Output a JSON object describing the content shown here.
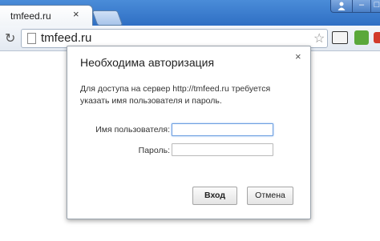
{
  "browser": {
    "tab": {
      "title": "tmfeed.ru",
      "close_glyph": "×"
    },
    "window_controls": {
      "user_icon": "user-icon",
      "minimize": "–",
      "maximize": "□"
    },
    "toolbar": {
      "reload_glyph": "↻",
      "url": "tmfeed.ru",
      "star_glyph": "☆"
    }
  },
  "dialog": {
    "title": "Необходима авторизация",
    "close_glyph": "×",
    "message": "Для доступа на сервер http://tmfeed.ru требуется указать имя пользователя и пароль.",
    "username_label": "Имя пользователя:",
    "username_value": "",
    "password_label": "Пароль:",
    "password_value": "",
    "login_button": "Вход",
    "cancel_button": "Отмена"
  },
  "colors": {
    "titlebar": "#2f6fc4",
    "focus_border": "#6d9fe0"
  }
}
